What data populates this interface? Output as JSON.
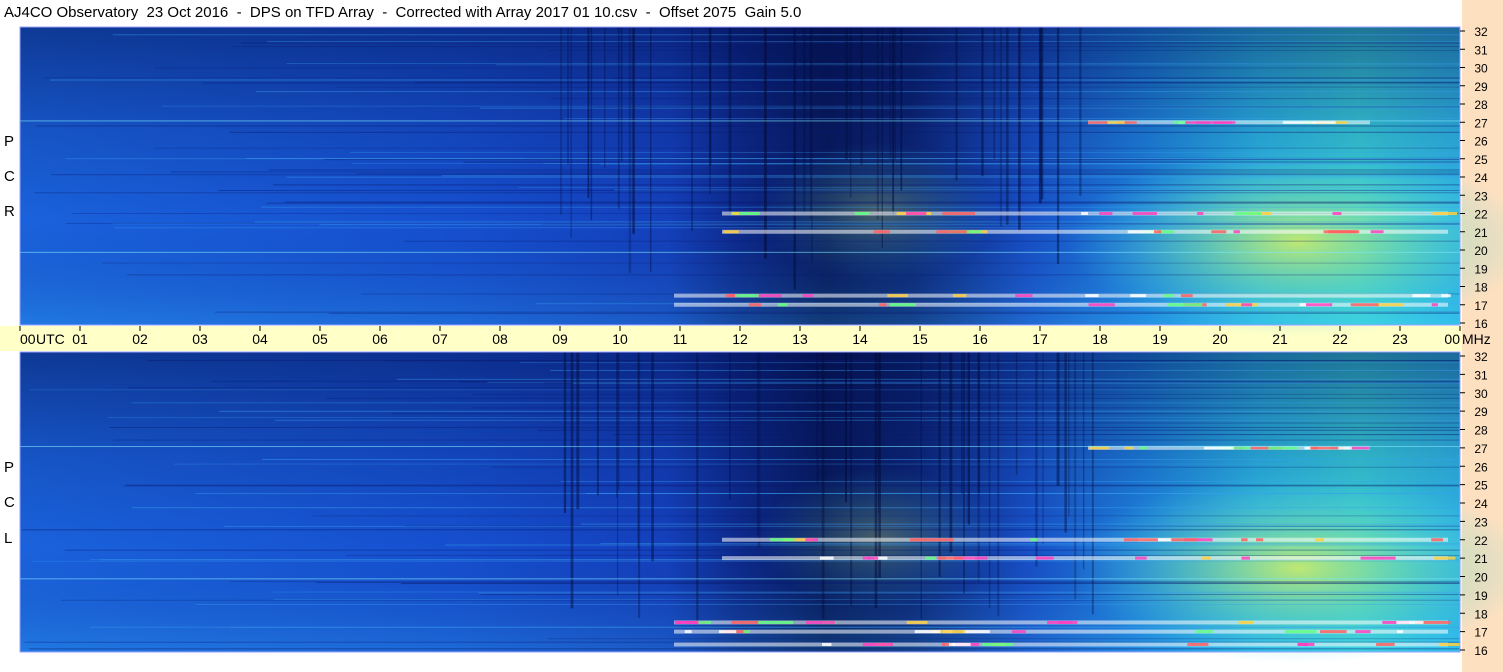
{
  "header": {
    "title": "AJ4CO Observatory  23 Oct 2016  -  DPS on TFD Array  -  Corrected with Array 2017 01 10.csv  -  Offset 2075  Gain 5.0"
  },
  "colors": {
    "frame_background": "#ffffff",
    "time_axis_band": "#ffffc8",
    "freq_axis_band": "#fde0c0",
    "panel_border": "#9aa0ff",
    "spectrum_low": "#0a1255",
    "spectrum_mid": "#1a4fd8",
    "spectrum_high": "#38c8e8",
    "spectrum_peak": "#fff04a"
  },
  "chart_data": {
    "type": "heatmap",
    "title": "AJ4CO Observatory  23 Oct 2016  -  DPS on TFD Array  -  Corrected with Array 2017 01 10.csv  -  Offset 2075  Gain 5.0",
    "x_axis": {
      "unit_label": "UTC",
      "ticks": [
        "00",
        "01",
        "02",
        "03",
        "04",
        "05",
        "06",
        "07",
        "08",
        "09",
        "10",
        "11",
        "12",
        "13",
        "14",
        "15",
        "16",
        "17",
        "18",
        "19",
        "20",
        "21",
        "22",
        "23",
        "00"
      ],
      "range_hours": [
        0,
        24
      ]
    },
    "y_axis": {
      "unit_label": "MHz",
      "ticks": [
        "32",
        "31",
        "30",
        "29",
        "28",
        "27",
        "26",
        "25",
        "24",
        "23",
        "22",
        "21",
        "20",
        "19",
        "18",
        "17",
        "16"
      ],
      "range_mhz": [
        16,
        32
      ]
    },
    "panels": [
      {
        "name": "RCP",
        "label_letters": [
          "R",
          "C",
          "P"
        ],
        "quiet_until_utc": 11,
        "darkest_utc": 13.5,
        "strong_interference_mhz": [
          27,
          22,
          21,
          17.5,
          17
        ]
      },
      {
        "name": "LCP",
        "label_letters": [
          "L",
          "C",
          "P"
        ],
        "quiet_until_utc": 11,
        "darkest_utc": 13.5,
        "strong_interference_mhz": [
          27,
          22,
          21,
          17.5,
          17,
          16.3
        ]
      }
    ]
  }
}
